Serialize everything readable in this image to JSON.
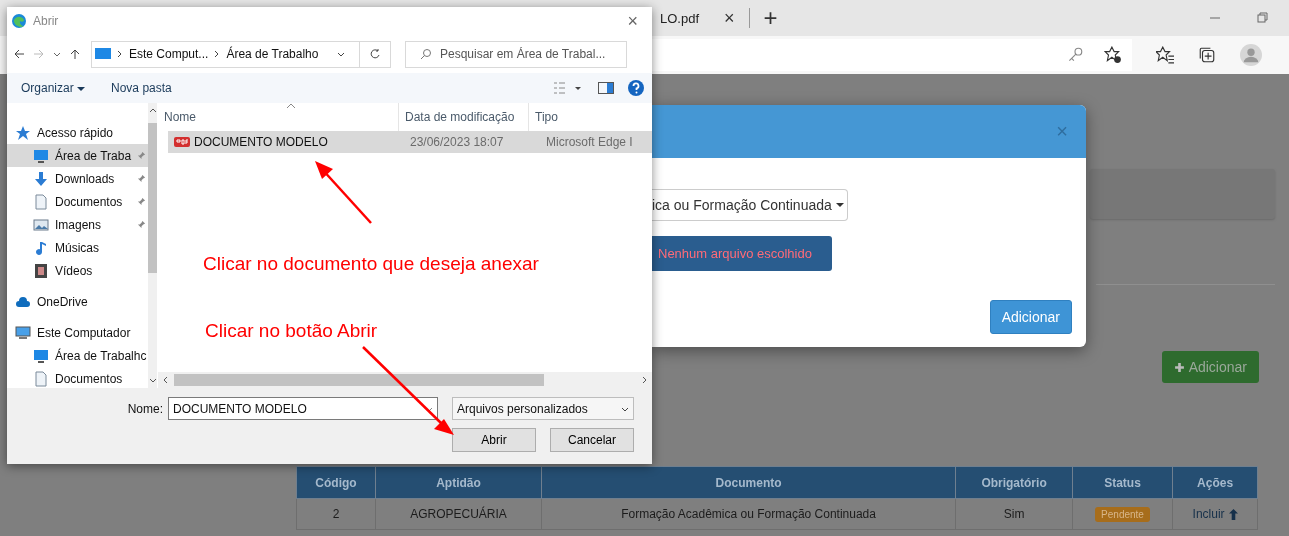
{
  "browser": {
    "tab_title": "LO.pdf",
    "tab_close": "×",
    "new_tab": "+"
  },
  "page": {
    "add_button": "Adicionar",
    "table": {
      "columns": [
        "Código",
        "Aptidão",
        "Documento",
        "Obrigatório",
        "Status",
        "Ações"
      ],
      "rows": [
        {
          "codigo": "2",
          "aptidao": "AGROPECUÁRIA",
          "documento": "Formação Acadêmica ou Formação Continuada",
          "obrigatorio": "Sim",
          "status": "Pendente",
          "acao": "Incluir"
        }
      ]
    }
  },
  "modal": {
    "close": "×",
    "select_value": "ica ou Formação Continuada",
    "file_status": "Nenhum arquivo escolhido",
    "submit": "Adicionar"
  },
  "dialog": {
    "title": "Abrir",
    "close": "×",
    "breadcrumb": [
      "Este Comput...",
      "Área de Trabalho"
    ],
    "search": {
      "placeholder": "Pesquisar em Área de Trabal..."
    },
    "toolbar": [
      "Organizar",
      "Nova pasta"
    ],
    "sidebar": [
      {
        "label": "Acesso rápido",
        "kind": "star",
        "selected": false,
        "pinned": false,
        "children": [
          {
            "label": "Área de Traba",
            "kind": "desktop",
            "selected": true,
            "pinned": true
          },
          {
            "label": "Downloads",
            "kind": "download",
            "selected": false,
            "pinned": true
          },
          {
            "label": "Documentos",
            "kind": "doc",
            "selected": false,
            "pinned": true
          },
          {
            "label": "Imagens",
            "kind": "image",
            "selected": false,
            "pinned": true
          },
          {
            "label": "Músicas",
            "kind": "music",
            "selected": false,
            "pinned": false
          },
          {
            "label": "Vídeos",
            "kind": "video",
            "selected": false,
            "pinned": false
          }
        ]
      },
      {
        "label": "OneDrive",
        "kind": "cloud",
        "selected": false,
        "pinned": false
      },
      {
        "label": "Este Computador",
        "kind": "pc",
        "selected": false,
        "pinned": false,
        "children": [
          {
            "label": "Área de Trabalhc",
            "kind": "desktop",
            "selected": false,
            "pinned": false
          },
          {
            "label": "Documentos",
            "kind": "doc",
            "selected": false,
            "pinned": false
          }
        ]
      }
    ],
    "columns": [
      "Nome",
      "Data de modificação",
      "Tipo"
    ],
    "files": [
      {
        "name": "DOCUMENTO MODELO",
        "date": "23/06/2023 18:07",
        "type": "Microsoft Edge I",
        "selected": true
      }
    ],
    "filename_label": "Nome:",
    "filename": "DOCUMENTO MODELO",
    "filetype": "Arquivos personalizados",
    "buttons": [
      "Abrir",
      "Cancelar"
    ]
  },
  "annotations": [
    "Clicar no documento que deseja anexar",
    "Clicar no botão Abrir"
  ]
}
